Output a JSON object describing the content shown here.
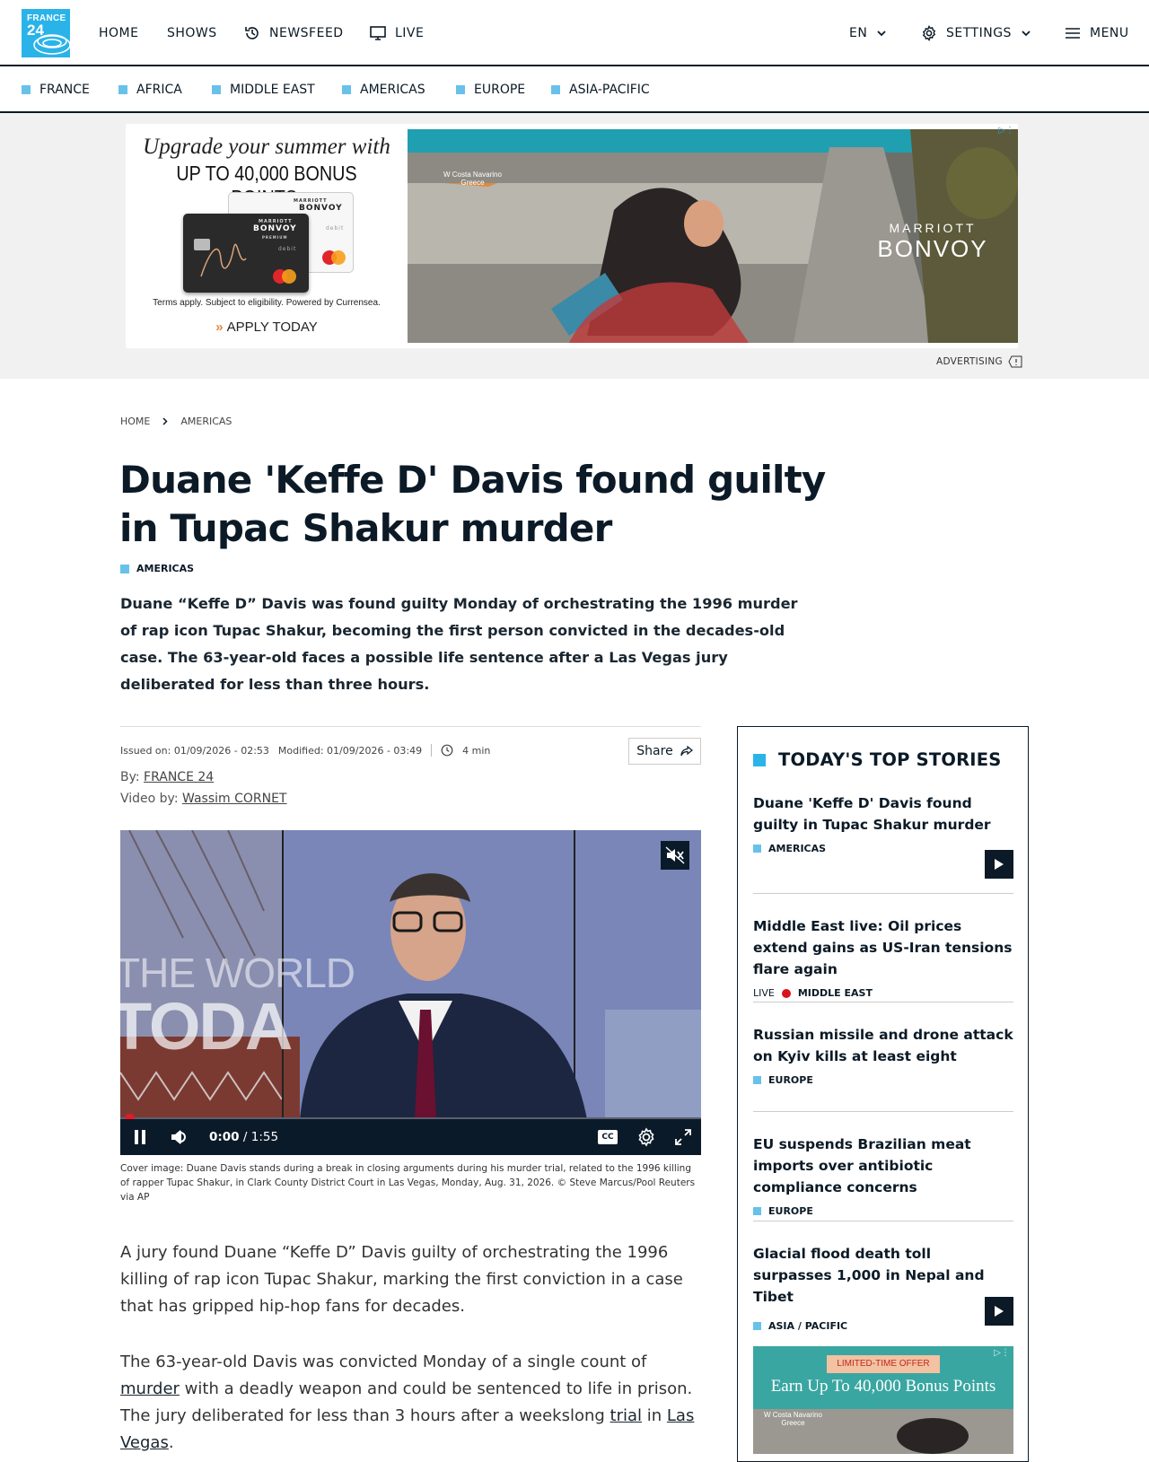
{
  "header": {
    "logo": {
      "line1": "FRANCE",
      "line2": "24"
    },
    "nav": {
      "home": "HOME",
      "shows": "SHOWS",
      "newsfeed": "NEWSFEED",
      "live": "LIVE"
    },
    "lang": "EN",
    "settings": "SETTINGS",
    "menu": "MENU"
  },
  "subnav": [
    "FRANCE",
    "AFRICA",
    "MIDDLE EAST",
    "AMERICAS",
    "EUROPE",
    "ASIA-PACIFIC"
  ],
  "ad": {
    "headline1": "Upgrade your summer with",
    "headline2": "UP TO 40,000 BONUS POINTS.",
    "card_brand_top": "MARRIOTT",
    "card_brand": "BONVOY",
    "card_premium": "PREMIUM",
    "card_debit": "debit",
    "terms": "Terms apply. Subject to eligibility. Powered by Currensea.",
    "cta": "APPLY TODAY",
    "location_line1": "W Costa Navarino",
    "location_line2": "Greece",
    "brand_line1": "MARRIOTT",
    "brand_line2": "BONVOY",
    "advertising_label": "ADVERTISING"
  },
  "breadcrumb": {
    "home": "HOME",
    "section": "AMERICAS"
  },
  "article": {
    "title": "Duane 'Keffe D' Davis found guilty in Tupac Shakur murder",
    "tag": "AMERICAS",
    "lead": "Duane “Keffe D” Davis was found guilty Monday of orchestrating the 1996 murder of rap icon Tupac Shakur, becoming the first person convicted in the decades-old case. The 63-year-old faces a possible life sentence after a Las Vegas jury deliberated for less than three hours.",
    "issued": "Issued on: 01/09/2026 - 02:53",
    "modified": "Modified: 01/09/2026 - 03:49",
    "read_time": "4 min",
    "share": "Share",
    "by_label": "By:",
    "author": "FRANCE 24",
    "video_by_label": "Video by:",
    "video_author": "Wassim CORNET",
    "video": {
      "overlay_line1": "THE WORLD",
      "overlay_line2": "TODA",
      "time_current": "0:00",
      "time_total": "1:55",
      "cc": "CC"
    },
    "caption": "Cover image: Duane Davis stands during a break in closing arguments during his murder trial, related to the 1996 killing of rapper Tupac Shakur, in Clark County District Court in Las Vegas, Monday, Aug. 31, 2026. © Steve Marcus/Pool Reuters via AP",
    "p1": "A jury found Duane “Keffe D” Davis guilty of orchestrating the 1996 killing of rap icon Tupac Shakur, marking the first conviction in a case that has gripped hip-hop fans for decades.",
    "p2": {
      "a": "The 63-year-old Davis was convicted Monday of a single count of ",
      "link1": "murder",
      "b": " with a deadly weapon and could be sentenced to life in prison. The jury deliberated for less than 3 hours after a weekslong ",
      "link2": "trial",
      "c": " in ",
      "link3": "Las Vegas",
      "d": "."
    }
  },
  "sidebar": {
    "title": "TODAY'S TOP STORIES",
    "stories": [
      {
        "title": "Duane 'Keffe D' Davis found guilty in Tupac Shakur murder",
        "category": "AMERICAS"
      },
      {
        "title": "Middle East live: Oil prices extend gains as US-Iran tensions flare again",
        "live": "LIVE",
        "category": "MIDDLE EAST"
      },
      {
        "title": "Russian missile and drone attack on Kyiv kills at least eight",
        "category": "EUROPE"
      },
      {
        "title": "EU suspends Brazilian meat imports over antibiotic compliance concerns",
        "category": "EUROPE"
      },
      {
        "title": "Glacial flood death toll surpasses 1,000 in Nepal and Tibet",
        "category": "ASIA / PACIFIC"
      }
    ],
    "ad": {
      "badge": "LIMITED-TIME OFFER",
      "headline": "Earn Up To 40,000 Bonus Points",
      "location_line1": "W Costa Navarino",
      "location_line2": "Greece"
    }
  },
  "colors": {
    "accent": "#2ab3e8",
    "square": "#68c1ea",
    "ink": "#0b1a26",
    "live": "#d9121c",
    "progress": "#e21b2b"
  }
}
